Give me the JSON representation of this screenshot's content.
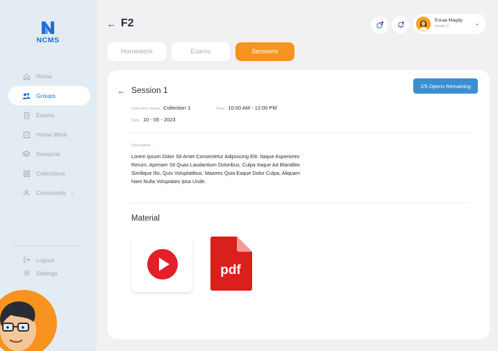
{
  "sidebar": {
    "logo_text": "NCMS",
    "items": [
      {
        "label": "Home",
        "icon": "home-icon"
      },
      {
        "label": "Groups",
        "icon": "groups-icon",
        "active": true
      },
      {
        "label": "Exams",
        "icon": "exams-icon"
      },
      {
        "label": "Home Work",
        "icon": "homework-icon"
      },
      {
        "label": "Sessions",
        "icon": "sessions-icon"
      },
      {
        "label": "Collections",
        "icon": "collections-icon"
      },
      {
        "label": "Community",
        "icon": "community-icon",
        "has_dropdown": true
      }
    ],
    "bottom": [
      {
        "label": "Logout",
        "icon": "logout-icon"
      },
      {
        "label": "Settings",
        "icon": "settings-icon"
      }
    ]
  },
  "header": {
    "title": "F2",
    "user": {
      "name": "Esraa Magdy",
      "role": "Senior 1"
    }
  },
  "tabs": [
    {
      "label": "Homework",
      "active": false
    },
    {
      "label": "Exams",
      "active": false
    },
    {
      "label": "Sessions",
      "active": true
    }
  ],
  "session": {
    "title": "Session 1",
    "opens_badge": "2/5 Opens Remaining",
    "collection_label": "Collection Name :",
    "collection_value": "Collection 1",
    "time_label": "Time :",
    "time_value": "10:00 AM - 12:00 PM",
    "date_label": "Date :",
    "date_value": "10 - 05 - 2023",
    "description_label": "Description :",
    "description": "Lorem Ipsum Dolor Sit Amet Consectetur Adipisicing Elit. Itaque Asperiores Rerum, Aperiam Sit Quas Laudantium Doloribus. Culpa Itaque Ad Blanditiis Similique Illo, Quis Voluptatibus. Maiores Quia Eaque Dolor Culpa, Aliquam Nam Nulla Voluptates Ipsa Unde.",
    "material_title": "Material",
    "pdf_label": "pdf"
  },
  "colors": {
    "accent": "#f7931e",
    "brand_blue": "#1f6fd1",
    "badge_blue": "#3b8fd1",
    "youtube_red": "#e3202a",
    "pdf_red": "#d9201c"
  }
}
